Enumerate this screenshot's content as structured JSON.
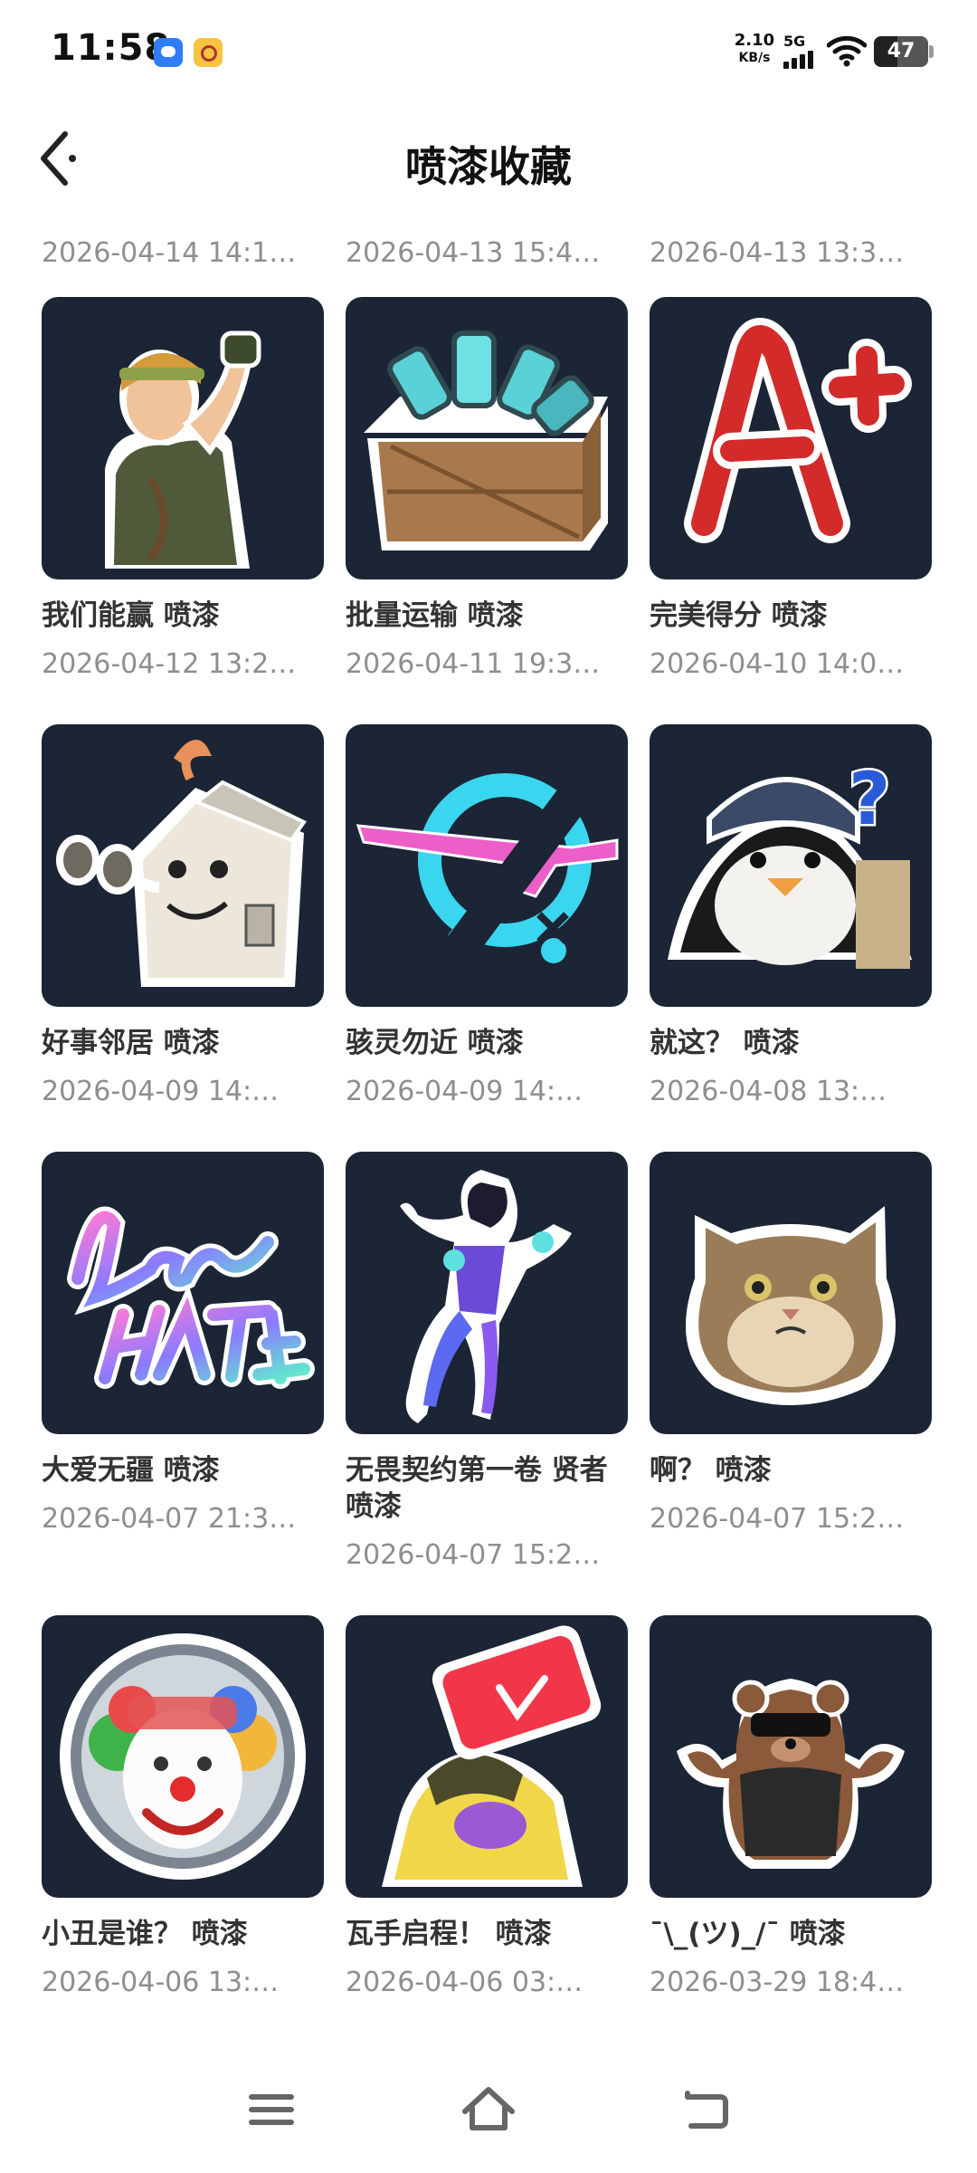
{
  "status_bar": {
    "time": "11:58",
    "speed_value": "2.10",
    "speed_unit": "KB/s",
    "network": "5G",
    "battery": "47"
  },
  "header": {
    "title": "喷漆收藏"
  },
  "partial_dates": [
    "2026-04-14 14:1…",
    "2026-04-13 15:4…",
    "2026-04-13 13:3…"
  ],
  "items": [
    {
      "name": "我们能赢 喷漆",
      "date": "2026-04-12 13:2…",
      "icon": "muscle-soldier-icon"
    },
    {
      "name": "批量运输 喷漆",
      "date": "2026-04-11 19:3…",
      "icon": "crate-icon"
    },
    {
      "name": "完美得分 喷漆",
      "date": "2026-04-10 14:0…",
      "icon": "a-plus-icon"
    },
    {
      "name": "好事邻居 喷漆",
      "date": "2026-04-09 14:…",
      "icon": "house-binoculars-icon"
    },
    {
      "name": "骇灵勿近 喷漆",
      "date": "2026-04-09 14:…",
      "icon": "no-gun-icon"
    },
    {
      "name": "就这？ 喷漆",
      "date": "2026-04-08 13:…",
      "icon": "penguin-question-icon"
    },
    {
      "name": "大爱无疆 喷漆",
      "date": "2026-04-07 21:3…",
      "icon": "love-over-hate-icon"
    },
    {
      "name": "无畏契约第一卷 贤者 喷漆",
      "date": "2026-04-07 15:2…",
      "icon": "sage-agent-icon"
    },
    {
      "name": "啊？ 喷漆",
      "date": "2026-04-07 15:2…",
      "icon": "cat-icon"
    },
    {
      "name": "小丑是谁？ 喷漆",
      "date": "2026-04-06 13:…",
      "icon": "clown-icon"
    },
    {
      "name": "瓦手启程！ 喷漆",
      "date": "2026-04-06 03:…",
      "icon": "phone-creature-icon"
    },
    {
      "name": "¯\\_(ツ)_/¯ 喷漆",
      "date": "2026-03-29 18:4…",
      "icon": "shrug-bear-icon"
    }
  ],
  "nav": {
    "menu_icon": "menu-icon",
    "home_icon": "home-icon",
    "back_icon": "back-icon"
  }
}
